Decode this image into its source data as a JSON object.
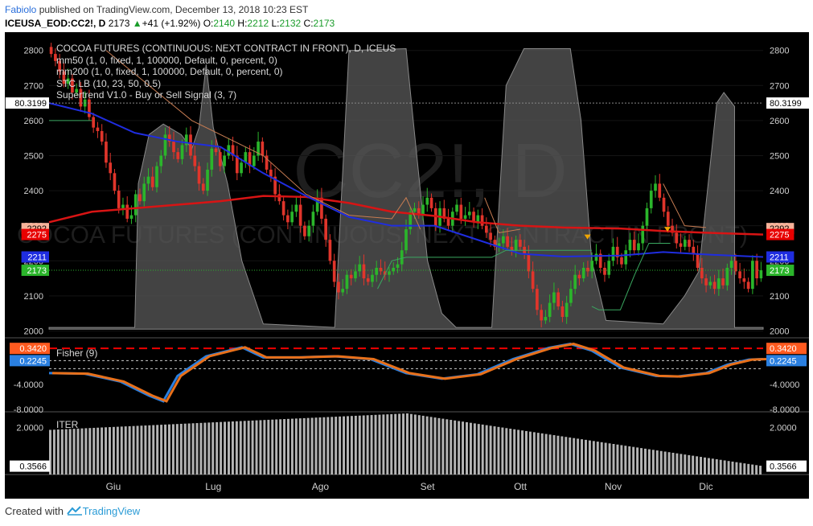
{
  "header": {
    "author": "Fabiolo",
    "published": " published on TradingView.com, December 13, 2018 10:23 EST",
    "symbol": "ICEUSA_EOD:CC2!, D",
    "last": "2173",
    "change_arrow": "▲",
    "change": "+41 (+1.92%)",
    "o_label": "O:",
    "o_value": "2140",
    "h_label": "H:",
    "h_value": "2212",
    "l_label": "L:",
    "l_value": "2132",
    "c_label": "C:",
    "c_value": "2173"
  },
  "watermark": {
    "big": "CC2!, D",
    "sub": "COCOA FUTURES (CONTINUOUS: NEXT CONTRACT IN FRONT)"
  },
  "legend": {
    "title": "COCOA FUTURES (CONTINUOUS: NEXT CONTRACT IN FRONT), D, ICEUS",
    "lines": [
      "mm50 (1, 0, fixed, 1, 100000, Default, 0, percent, 0)",
      "mm200 (1, 0, fixed, 1, 100000, Default, 0, percent, 0)",
      "STC LB (10, 23, 50, 0.5)",
      "Supertrend V1.0 - Buy or Sell Signal (3, 7)"
    ]
  },
  "footer": {
    "prefix": "Created with",
    "brand": "TradingView"
  },
  "colors": {
    "bg": "#000000",
    "up": "#2bb52b",
    "down": "#e0352b",
    "mm50": "#1f2de0",
    "mm200": "#d81414",
    "stc_fill": "#5a5a5a",
    "supertrend_up": "#3aa860",
    "supertrend_down": "#c77c52",
    "fisher1": "#2a7fe0",
    "fisher2": "#e8701a",
    "iter": "#b5b5b5"
  },
  "chart_data": [
    {
      "type": "candlestick",
      "title": "COCOA FUTURES (CONTINUOUS: NEXT CONTRACT IN FRONT), D, ICEUS",
      "x_labels": [
        "Giu",
        "Lug",
        "Ago",
        "Set",
        "Ott",
        "Nov",
        "Dic"
      ],
      "y_ticks": [
        2000,
        2100,
        2200,
        2300,
        2400,
        2500,
        2600,
        2700,
        2800
      ],
      "ylim": [
        1985,
        2820
      ],
      "price_labels": [
        {
          "value": "80.3199",
          "style": "plain",
          "y": 2650
        },
        {
          "value": "2292",
          "style": "salmon",
          "y": 2292
        },
        {
          "value": "2275",
          "style": "red",
          "y": 2275
        },
        {
          "value": "2211",
          "style": "blue",
          "y": 2211
        },
        {
          "value": "2173",
          "style": "green",
          "y": 2173
        }
      ],
      "closes": [
        2790,
        2770,
        2740,
        2705,
        2720,
        2680,
        2690,
        2640,
        2660,
        2610,
        2580,
        2570,
        2540,
        2480,
        2450,
        2400,
        2350,
        2360,
        2320,
        2330,
        2390,
        2370,
        2420,
        2440,
        2410,
        2470,
        2500,
        2560,
        2540,
        2510,
        2490,
        2530,
        2560,
        2500,
        2470,
        2420,
        2400,
        2460,
        2520,
        2510,
        2470,
        2500,
        2530,
        2500,
        2450,
        2480,
        2510,
        2470,
        2500,
        2540,
        2500,
        2460,
        2440,
        2390,
        2370,
        2330,
        2310,
        2340,
        2360,
        2300,
        2270,
        2300,
        2340,
        2380,
        2320,
        2260,
        2200,
        2140,
        2110,
        2120,
        2160,
        2150,
        2170,
        2190,
        2150,
        2140,
        2160,
        2180,
        2170,
        2160,
        2170,
        2180,
        2190,
        2230,
        2290,
        2340,
        2350,
        2330,
        2360,
        2380,
        2350,
        2300,
        2350,
        2320,
        2300,
        2340,
        2360,
        2320,
        2330,
        2340,
        2310,
        2330,
        2300,
        2280,
        2260,
        2240,
        2250,
        2270,
        2240,
        2230,
        2260,
        2240,
        2220,
        2170,
        2120,
        2060,
        2030,
        2040,
        2080,
        2110,
        2070,
        2040,
        2080,
        2120,
        2160,
        2150,
        2180,
        2170,
        2200,
        2220,
        2180,
        2160,
        2200,
        2240,
        2210,
        2190,
        2230,
        2260,
        2230,
        2250,
        2300,
        2350,
        2400,
        2420,
        2380,
        2340,
        2300,
        2280,
        2250,
        2240,
        2260,
        2240,
        2220,
        2180,
        2150,
        2130,
        2140,
        2120,
        2150,
        2130,
        2180,
        2200,
        2170,
        2150,
        2140,
        2120,
        2200,
        2150,
        2173
      ],
      "series": [
        {
          "name": "mm50",
          "points": [
            [
              0,
              2650
            ],
            [
              0.06,
              2620
            ],
            [
              0.12,
              2565
            ],
            [
              0.18,
              2540
            ],
            [
              0.24,
              2525
            ],
            [
              0.3,
              2450
            ],
            [
              0.36,
              2385
            ],
            [
              0.42,
              2325
            ],
            [
              0.48,
              2300
            ],
            [
              0.54,
              2300
            ],
            [
              0.6,
              2260
            ],
            [
              0.66,
              2220
            ],
            [
              0.72,
              2212
            ],
            [
              0.8,
              2215
            ],
            [
              0.86,
              2225
            ],
            [
              0.92,
              2218
            ],
            [
              1,
              2211
            ]
          ]
        },
        {
          "name": "mm200",
          "points": [
            [
              0,
              2310
            ],
            [
              0.06,
              2340
            ],
            [
              0.12,
              2350
            ],
            [
              0.18,
              2360
            ],
            [
              0.24,
              2370
            ],
            [
              0.3,
              2385
            ],
            [
              0.36,
              2382
            ],
            [
              0.42,
              2365
            ],
            [
              0.48,
              2340
            ],
            [
              0.54,
              2328
            ],
            [
              0.6,
              2310
            ],
            [
              0.66,
              2300
            ],
            [
              0.72,
              2295
            ],
            [
              0.8,
              2292
            ],
            [
              0.86,
              2285
            ],
            [
              0.92,
              2280
            ],
            [
              1,
              2275
            ]
          ]
        },
        {
          "name": "STC LB",
          "points": [
            [
              0,
              2010
            ],
            [
              0.12,
              2010
            ],
            [
              0.125,
              2420
            ],
            [
              0.14,
              2560
            ],
            [
              0.16,
              2590
            ],
            [
              0.185,
              2560
            ],
            [
              0.2,
              2520
            ],
            [
              0.21,
              2580
            ],
            [
              0.22,
              2760
            ],
            [
              0.23,
              2580
            ],
            [
              0.25,
              2420
            ],
            [
              0.27,
              2200
            ],
            [
              0.3,
              2020
            ],
            [
              0.4,
              2010
            ],
            [
              0.42,
              2800
            ],
            [
              0.5,
              2805
            ],
            [
              0.51,
              2600
            ],
            [
              0.53,
              2200
            ],
            [
              0.55,
              2050
            ],
            [
              0.57,
              2010
            ],
            [
              0.62,
              2010
            ],
            [
              0.64,
              2700
            ],
            [
              0.665,
              2805
            ],
            [
              0.73,
              2805
            ],
            [
              0.745,
              2600
            ],
            [
              0.76,
              2200
            ],
            [
              0.78,
              2030
            ],
            [
              0.86,
              2020
            ],
            [
              0.89,
              2100
            ],
            [
              0.91,
              2170
            ],
            [
              0.935,
              2650
            ],
            [
              0.945,
              2680
            ],
            [
              0.96,
              2640
            ],
            [
              0.96,
              2010
            ],
            [
              1,
              2010
            ]
          ]
        }
      ]
    },
    {
      "type": "line",
      "title": "Fisher (9)",
      "series": [
        {
          "name": "Fisher (9)",
          "points": [
            [
              0,
              -2.0
            ],
            [
              0.05,
              -2.1
            ],
            [
              0.1,
              -3.5
            ],
            [
              0.14,
              -6.0
            ],
            [
              0.16,
              -7.0
            ],
            [
              0.18,
              -2.5
            ],
            [
              0.22,
              1.0
            ],
            [
              0.27,
              2.6
            ],
            [
              0.3,
              0.8
            ],
            [
              0.35,
              0.8
            ],
            [
              0.4,
              1.0
            ],
            [
              0.45,
              0.5
            ],
            [
              0.5,
              -2.0
            ],
            [
              0.55,
              -3.0
            ],
            [
              0.6,
              -2.2
            ],
            [
              0.65,
              0.5
            ],
            [
              0.7,
              2.5
            ],
            [
              0.73,
              3.2
            ],
            [
              0.76,
              2.0
            ],
            [
              0.8,
              -1.0
            ],
            [
              0.85,
              -2.5
            ],
            [
              0.88,
              -2.6
            ],
            [
              0.92,
              -2.0
            ],
            [
              0.95,
              -0.5
            ],
            [
              0.98,
              0.4
            ],
            [
              1,
              0.5
            ]
          ]
        }
      ],
      "y_ticks": [
        -4.0
      ],
      "price_labels": [
        "0.3420",
        "0.2245"
      ],
      "hlines": [
        -8.0,
        2.4,
        0.2245,
        -1.2
      ]
    },
    {
      "type": "bar",
      "title": "ITER",
      "y_ticks": [
        2.0
      ],
      "price_labels": [
        "0.3566"
      ]
    }
  ]
}
